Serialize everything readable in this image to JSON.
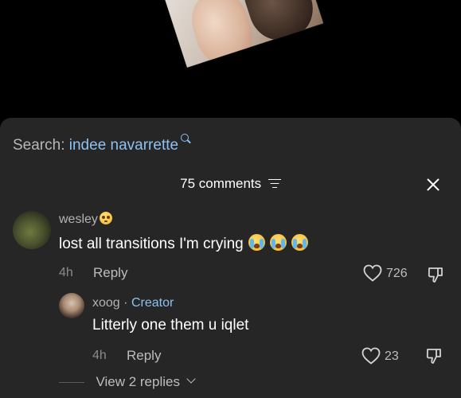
{
  "search": {
    "label": "Search:",
    "term": "indee navarrette"
  },
  "header": {
    "comments_count": "75 comments"
  },
  "comments": [
    {
      "username": "wesley",
      "text": "lost all transitions I'm crying",
      "time": "4h",
      "reply_label": "Reply",
      "likes": "726"
    },
    {
      "username": "xoog",
      "separator": "·",
      "badge": "Creator",
      "text": "Litterly one them u iqlet",
      "time": "4h",
      "reply_label": "Reply",
      "likes": "23"
    }
  ],
  "view_replies": "View 2 replies",
  "colors": {
    "accent": "#8cc1f0",
    "sheet_bg": "#262626"
  },
  "icons": [
    "search-icon",
    "filter-icon",
    "close-icon",
    "heart-icon",
    "dislike-icon",
    "chevron-down-icon"
  ]
}
